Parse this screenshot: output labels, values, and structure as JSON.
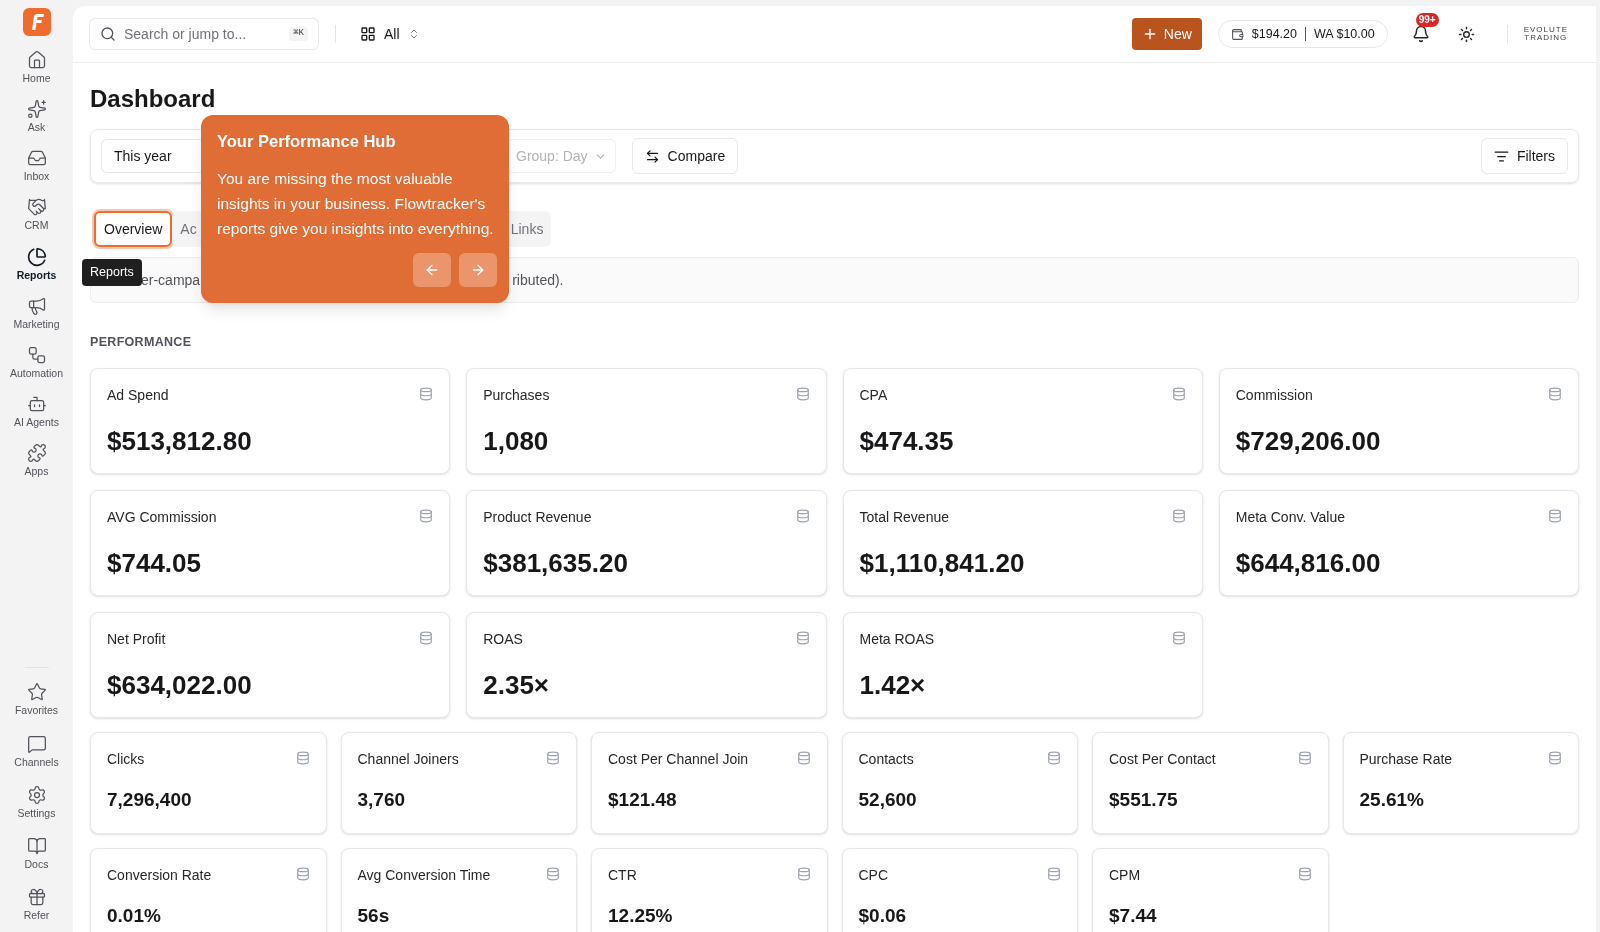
{
  "sidebar": {
    "items": [
      {
        "label": "Home",
        "selected": false
      },
      {
        "label": "Ask",
        "selected": false
      },
      {
        "label": "Inbox",
        "selected": false
      },
      {
        "label": "CRM",
        "selected": false
      },
      {
        "label": "Reports",
        "selected": true
      },
      {
        "label": "Marketing",
        "selected": false
      },
      {
        "label": "Automation",
        "selected": false
      },
      {
        "label": "AI Agents",
        "selected": false
      },
      {
        "label": "Apps",
        "selected": false
      }
    ],
    "bottom_items": [
      {
        "label": "Favorites",
        "selected": false
      },
      {
        "label": "Channels",
        "selected": false
      },
      {
        "label": "Settings",
        "selected": false
      },
      {
        "label": "Docs",
        "selected": false
      },
      {
        "label": "Refer",
        "selected": false
      }
    ],
    "tooltip": "Reports"
  },
  "topbar": {
    "search": {
      "placeholder": "Search or jump to...",
      "shortcut": "⌘K"
    },
    "workspace": "All",
    "new_button": "New",
    "balance": "$194.20",
    "wa_balance": "WA $10.00",
    "notifications": "99+",
    "brand": [
      "EVOLUTE",
      "TRADING"
    ]
  },
  "title": "Dashboard",
  "filters": {
    "date_range": "This year",
    "group": "Group: Day",
    "compare": "Compare",
    "filters": "Filters"
  },
  "tabs": [
    {
      "label": "Overview",
      "selected": true
    },
    {
      "label": "Ac",
      "selected": false
    },
    {
      "label": "Links",
      "selected": false
    }
  ],
  "info": [
    "er-campa",
    "ributed)."
  ],
  "tour": {
    "title": "Your Performance Hub",
    "body": "You are missing the most valuable insights in your business. Flowtracker's reports give you insights into everything."
  },
  "section": "PERFORMANCE",
  "groups": [
    {
      "kind": "large",
      "cards": [
        {
          "label": "Ad Spend",
          "value": "$513,812.80"
        },
        {
          "label": "Purchases",
          "value": "1,080"
        },
        {
          "label": "CPA",
          "value": "$474.35"
        },
        {
          "label": "Commission",
          "value": "$729,206.00"
        },
        {
          "label": "AVG Commission",
          "value": "$744.05"
        },
        {
          "label": "Product Revenue",
          "value": "$381,635.20"
        },
        {
          "label": "Total Revenue",
          "value": "$1,110,841.20"
        },
        {
          "label": "Meta Conv. Value",
          "value": "$644,816.00"
        },
        {
          "label": "Net Profit",
          "value": "$634,022.00"
        },
        {
          "label": "ROAS",
          "value": "2.35×"
        },
        {
          "label": "Meta ROAS",
          "value": "1.42×"
        }
      ]
    },
    {
      "kind": "small",
      "cards": [
        {
          "label": "Clicks",
          "value": "7,296,400"
        },
        {
          "label": "Channel Joiners",
          "value": "3,760"
        },
        {
          "label": "Cost Per Channel Join",
          "value": "$121.48"
        },
        {
          "label": "Contacts",
          "value": "52,600"
        },
        {
          "label": "Cost Per Contact",
          "value": "$551.75"
        },
        {
          "label": "Purchase Rate",
          "value": "25.61%"
        },
        {
          "label": "Conversion Rate",
          "value": "0.01%"
        },
        {
          "label": "Avg Conversion Time",
          "value": "56s"
        },
        {
          "label": "CTR",
          "value": "12.25%"
        },
        {
          "label": "CPC",
          "value": "$0.06"
        },
        {
          "label": "CPM",
          "value": "$7.44"
        }
      ]
    }
  ]
}
